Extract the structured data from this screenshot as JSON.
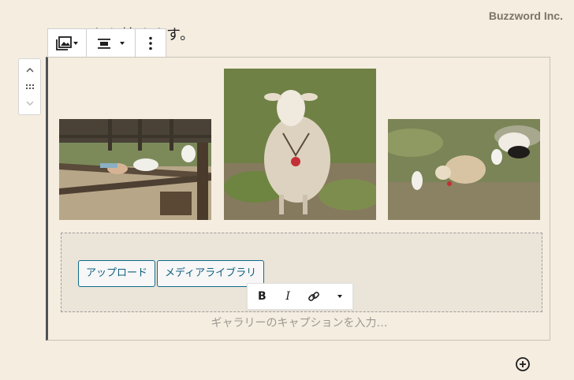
{
  "watermark": "Buzzword Inc.",
  "paragraph_text": "ここから始めます。",
  "block_toolbar": {
    "icons": [
      "gallery-icon",
      "align-center-icon",
      "more-options-icon"
    ]
  },
  "mover": {
    "icons": [
      "chevron-up-icon",
      "drag-handle-icon",
      "chevron-down-icon"
    ]
  },
  "gallery": {
    "images": [
      "goats-on-fence-photo",
      "sheep-photo",
      "sheep-flock-photo"
    ],
    "upload_label": "アップロード",
    "media_library_label": "メディアライブラリ",
    "caption_placeholder": "ギャラリーのキャプションを入力…"
  },
  "format_toolbar": {
    "bold_label": "B",
    "italic_label": "I",
    "icons": [
      "link-icon",
      "dropdown-arrow-icon"
    ]
  },
  "colors": {
    "background": "#f4ede0",
    "accent": "#0f6a8c",
    "block_border": "#4f5358"
  }
}
